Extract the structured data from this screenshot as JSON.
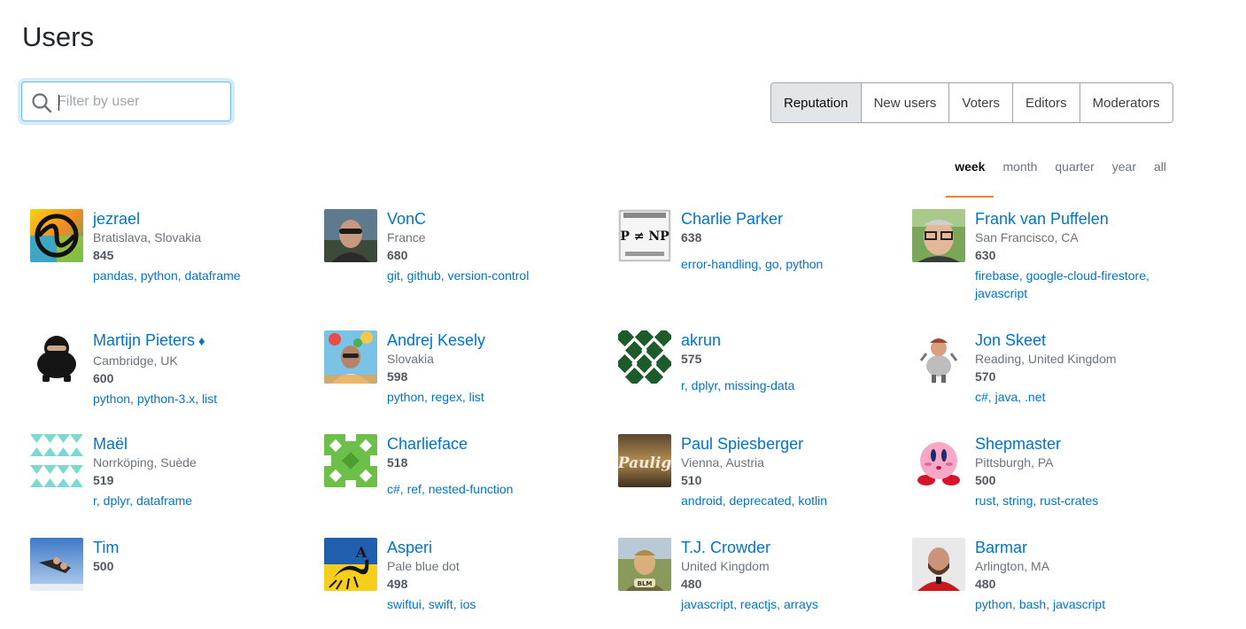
{
  "page": {
    "title": "Users"
  },
  "search": {
    "placeholder": "Filter by user",
    "value": ""
  },
  "filters": {
    "tabs": [
      {
        "label": "Reputation",
        "active": true
      },
      {
        "label": "New users"
      },
      {
        "label": "Voters"
      },
      {
        "label": "Editors"
      },
      {
        "label": "Moderators"
      }
    ]
  },
  "periods": [
    {
      "label": "week",
      "active": true
    },
    {
      "label": "month"
    },
    {
      "label": "quarter"
    },
    {
      "label": "year"
    },
    {
      "label": "all"
    }
  ],
  "users": [
    {
      "name": "jezrael",
      "location": "Bratislava, Slovakia",
      "rep": "845",
      "tags": [
        "pandas",
        "python",
        "dataframe"
      ]
    },
    {
      "name": "VonC",
      "location": "France",
      "rep": "680",
      "tags": [
        "git",
        "github",
        "version-control"
      ]
    },
    {
      "name": "Charlie Parker",
      "location": "",
      "rep": "638",
      "tags": [
        "error-handling",
        "go",
        "python"
      ]
    },
    {
      "name": "Frank van Puffelen",
      "location": "San Francisco, CA",
      "rep": "630",
      "tags": [
        "firebase",
        "google-cloud-firestore",
        "javascript"
      ]
    },
    {
      "name": "Martijn Pieters",
      "moderator": "♦",
      "location": "Cambridge, UK",
      "rep": "600",
      "tags": [
        "python",
        "python-3.x",
        "list"
      ]
    },
    {
      "name": "Andrej Kesely",
      "location": "Slovakia",
      "rep": "598",
      "tags": [
        "python",
        "regex",
        "list"
      ]
    },
    {
      "name": "akrun",
      "location": "",
      "rep": "575",
      "tags": [
        "r",
        "dplyr",
        "missing-data"
      ]
    },
    {
      "name": "Jon Skeet",
      "location": "Reading, United Kingdom",
      "rep": "570",
      "tags": [
        "c#",
        "java",
        ".net"
      ]
    },
    {
      "name": "Maël",
      "location": "Norrköping, Suède",
      "rep": "519",
      "tags": [
        "r",
        "dplyr",
        "dataframe"
      ]
    },
    {
      "name": "Charlieface",
      "location": "",
      "rep": "518",
      "tags": [
        "c#",
        "ref",
        "nested-function"
      ]
    },
    {
      "name": "Paul Spiesberger",
      "location": "Vienna, Austria",
      "rep": "510",
      "tags": [
        "android",
        "deprecated",
        "kotlin"
      ]
    },
    {
      "name": "Shepmaster",
      "location": "Pittsburgh, PA",
      "rep": "500",
      "tags": [
        "rust",
        "string",
        "rust-crates"
      ]
    },
    {
      "name": "Tim",
      "location": "",
      "rep": "500",
      "tags": []
    },
    {
      "name": "Asperi",
      "location": "Pale blue dot",
      "rep": "498",
      "tags": [
        "swiftui",
        "swift",
        "ios"
      ]
    },
    {
      "name": "T.J. Crowder",
      "location": "United Kingdom",
      "rep": "480",
      "tags": [
        "javascript",
        "reactjs",
        "arrays"
      ]
    },
    {
      "name": "Barmar",
      "location": "Arlington, MA",
      "rep": "480",
      "tags": [
        "python",
        "bash",
        "javascript"
      ]
    }
  ],
  "avatar_art": {
    "charlie_parker_sign": "P ≠ NP",
    "paul_spiesberger_sign": "Paulig",
    "tj_crowder_badge": "BLM"
  },
  "colors": {
    "link": "#0074cc",
    "active_period_underline": "#f48225",
    "focus_ring": "#6bbbf7"
  }
}
